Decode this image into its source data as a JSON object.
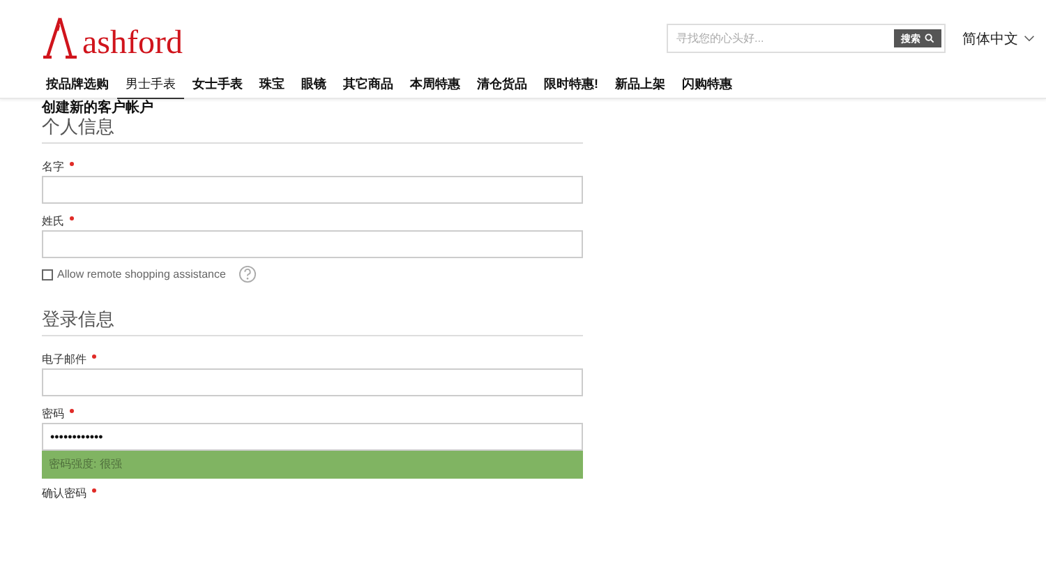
{
  "header": {
    "logo": "ashford",
    "search": {
      "placeholder": "寻找您的心头好...",
      "button": "搜索"
    },
    "language": "简体中文"
  },
  "nav": [
    {
      "label": "按品牌选购",
      "selected": false
    },
    {
      "label": "男士手表",
      "selected": true
    },
    {
      "label": "女士手表",
      "selected": false
    },
    {
      "label": "珠宝",
      "selected": false
    },
    {
      "label": "眼镜",
      "selected": false
    },
    {
      "label": "其它商品",
      "selected": false
    },
    {
      "label": "本周特惠",
      "selected": false
    },
    {
      "label": "清仓货品",
      "selected": false
    },
    {
      "label": "限时特惠!",
      "selected": false
    },
    {
      "label": "新品上架",
      "selected": false
    },
    {
      "label": "闪购特惠",
      "selected": false
    }
  ],
  "page_title": "创建新的客户帐户",
  "sections": [
    {
      "title": "个人信息",
      "items": [
        {
          "kind": "field",
          "label": "名字",
          "required": true
        },
        {
          "kind": "field",
          "label": "姓氏",
          "required": true
        },
        {
          "kind": "checkbox",
          "label": "Allow remote shopping assistance",
          "checked": false
        }
      ]
    },
    {
      "title": "登录信息",
      "items": [
        {
          "kind": "field",
          "label": "电子邮件",
          "required": true
        },
        {
          "kind": "password",
          "label": "密码",
          "required": true,
          "value": "••••••••••••",
          "strength_text": "密码强度: 很强"
        },
        {
          "kind": "label",
          "label": "确认密码",
          "required": true
        }
      ]
    }
  ]
}
